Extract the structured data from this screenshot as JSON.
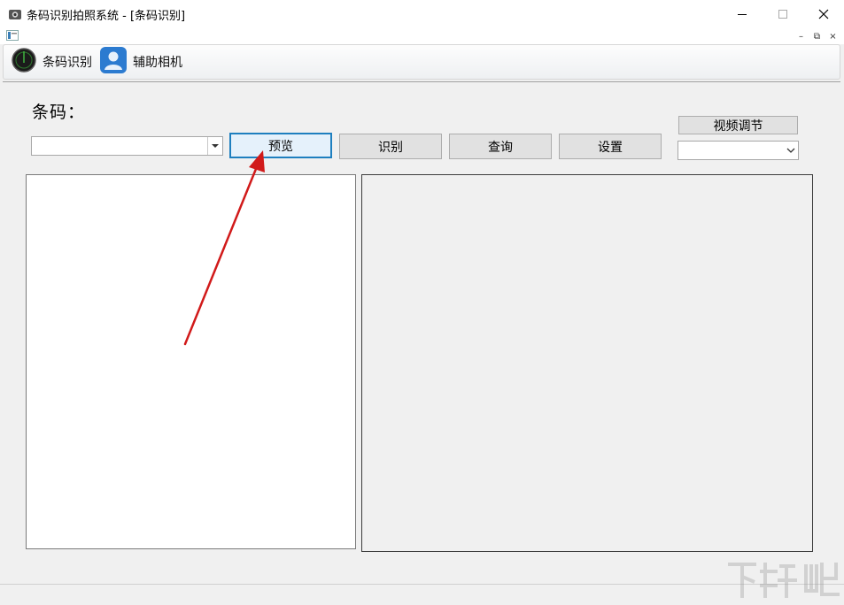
{
  "window": {
    "title": "条码识别拍照系统 - [条码识别]",
    "controls": {
      "minimize": "—",
      "maximize": "☐",
      "close": "✕"
    }
  },
  "mdi": {
    "minimize": "–",
    "restore": "⧉",
    "close": "×"
  },
  "toolbar": {
    "items": [
      {
        "label": "条码识别",
        "icon": "barcode-disc-icon"
      },
      {
        "label": "辅助相机",
        "icon": "user-camera-icon"
      }
    ]
  },
  "main": {
    "barcode_label": "条码：",
    "barcode_value": "",
    "buttons": {
      "preview": "预览",
      "recognize": "识别",
      "query": "查询",
      "settings": "设置",
      "video": "视频调节"
    },
    "video_select_value": ""
  },
  "colors": {
    "focus_border": "#1e7fbf",
    "annotation_arrow": "#d11a1a"
  }
}
